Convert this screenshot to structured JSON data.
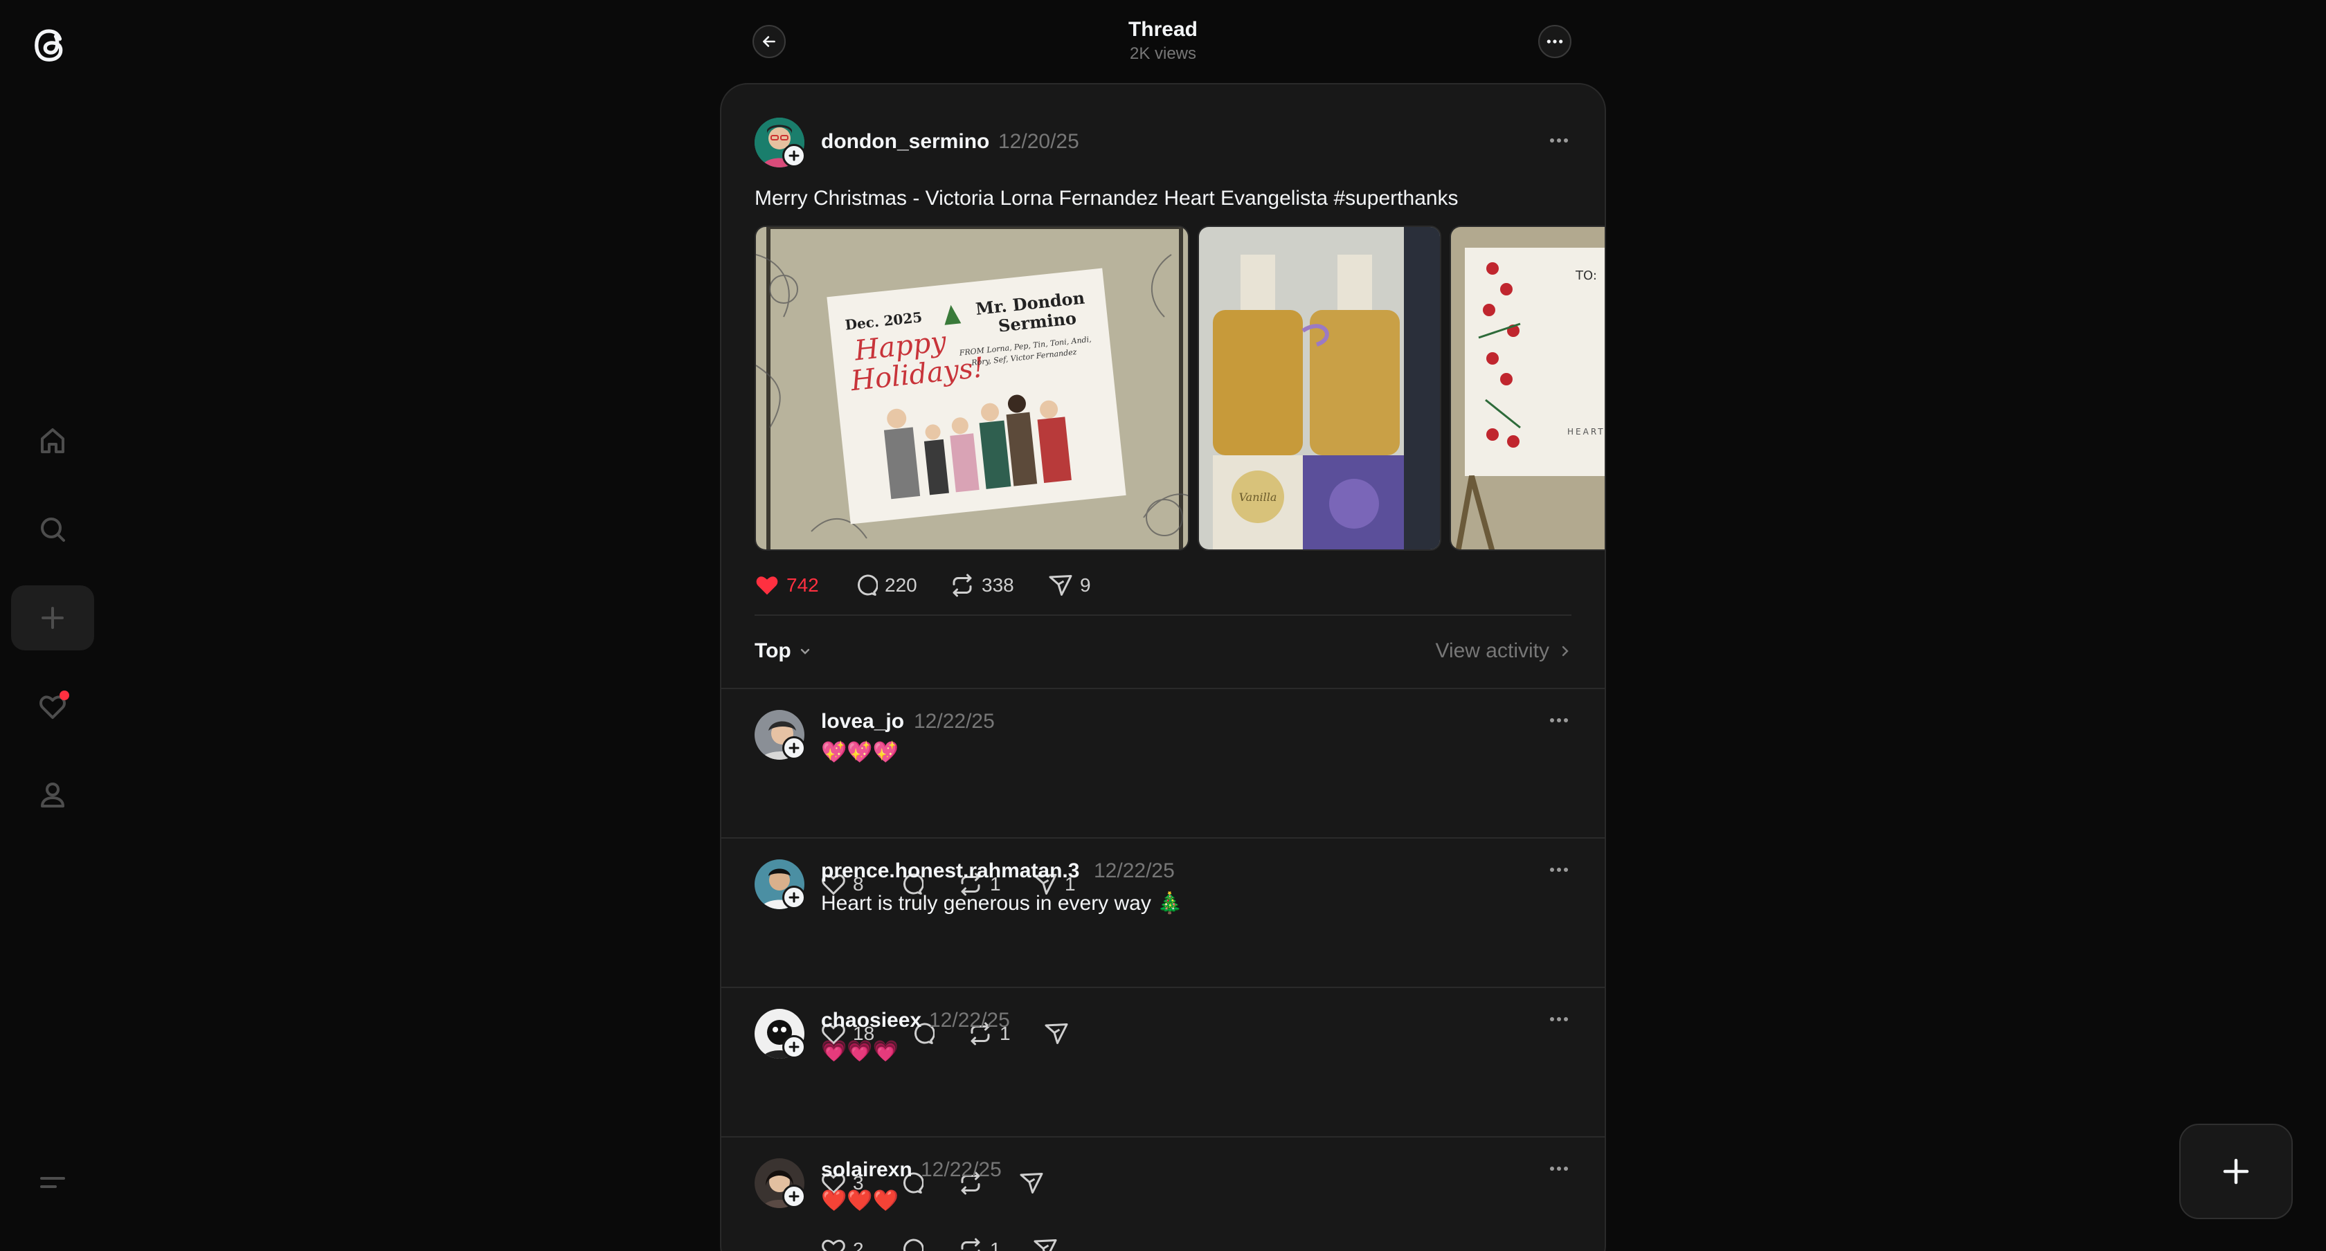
{
  "header": {
    "title": "Thread",
    "views": "2K views"
  },
  "post": {
    "username": "dondon_sermino",
    "date": "12/20/25",
    "text": "Merry Christmas - Victoria Lorna Fernandez Heart Evangelista #superthanks",
    "card_text": {
      "date_line": "Dec. 2025",
      "greeting1": "Happy",
      "greeting2": "Holidays!",
      "to_line": "Mr. Dondon",
      "to_line2": "Sermino",
      "from_line": "FROM Lorna, Pep, Tin, Toni, Andi,",
      "from_line2": "Rory, Sef, Victor Fernandez"
    },
    "bottle_label": "Vanilla",
    "third_card": {
      "to": "TO:",
      "sig": "HEART E"
    },
    "likes": "742",
    "comments": "220",
    "reposts": "338",
    "shares": "9"
  },
  "sort": {
    "label": "Top",
    "view_activity": "View activity"
  },
  "replies": [
    {
      "username": "lovea_jo",
      "date": "12/22/25",
      "text": "💖💖💖",
      "likes": "8",
      "comments": "",
      "reposts": "1",
      "shares": "1"
    },
    {
      "username": "prence.honest.rahmatan.3",
      "date": "12/22/25",
      "text": "Heart is truly generous in every way 🎄",
      "likes": "18",
      "comments": "",
      "reposts": "1",
      "shares": ""
    },
    {
      "username": "chaosieex",
      "date": "12/22/25",
      "text": "💗💗💗",
      "likes": "3",
      "comments": "",
      "reposts": "",
      "shares": ""
    },
    {
      "username": "solairexn",
      "date": "12/22/25",
      "text": "❤️❤️❤️",
      "likes": "2",
      "comments": "",
      "reposts": "1",
      "shares": ""
    }
  ],
  "colors": {
    "accent_like": "#ff3040",
    "background": "#0a0a0a",
    "card": "#181818",
    "muted": "#777777"
  },
  "icons": [
    "threads-logo-icon",
    "home-icon",
    "search-icon",
    "create-icon",
    "activity-icon",
    "profile-icon",
    "menu-icon",
    "back-arrow-icon",
    "more-icon",
    "heart-icon",
    "comment-icon",
    "repost-icon",
    "share-icon",
    "chevron-down-icon",
    "chevron-right-icon",
    "plus-icon"
  ]
}
